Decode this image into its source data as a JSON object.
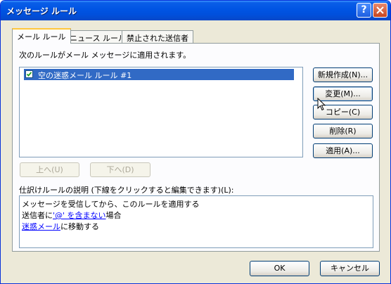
{
  "window": {
    "title": "メッセージ ルール",
    "help_glyph": "?",
    "close_glyph": "×"
  },
  "tabs": [
    {
      "label": "メール ルール",
      "active": true
    },
    {
      "label": "ニュース ルール",
      "active": false
    },
    {
      "label": "禁止された送信者",
      "active": false
    }
  ],
  "rules_heading": "次のルールがメール メッセージに適用されます。",
  "rules": [
    {
      "label": "空の迷惑メール ルール #1",
      "checked": true,
      "selected": true
    }
  ],
  "buttons": {
    "new": "新規作成(N)...",
    "modify": "変更(M)...",
    "copy": "コピー(C)",
    "remove": "削除(R)",
    "apply": "適用(A)...",
    "move_up": "上へ(U)",
    "move_down": "下へ(D)",
    "ok": "OK",
    "cancel": "キャンセル"
  },
  "description": {
    "heading": "仕訳けルールの説明 (下線をクリックすると編集できます)(L):",
    "line1": "メッセージを受信してから、このルールを適用する",
    "line2_prefix": "送信者に",
    "line2_link": "'@' を含まない",
    "line2_suffix": "場合",
    "line3_link": "迷惑メール",
    "line3_suffix": "に移動する"
  },
  "colors": {
    "title_bar": "#0054e3",
    "selection": "#316ac5",
    "face": "#ece9d8",
    "link": "#0000ff"
  }
}
